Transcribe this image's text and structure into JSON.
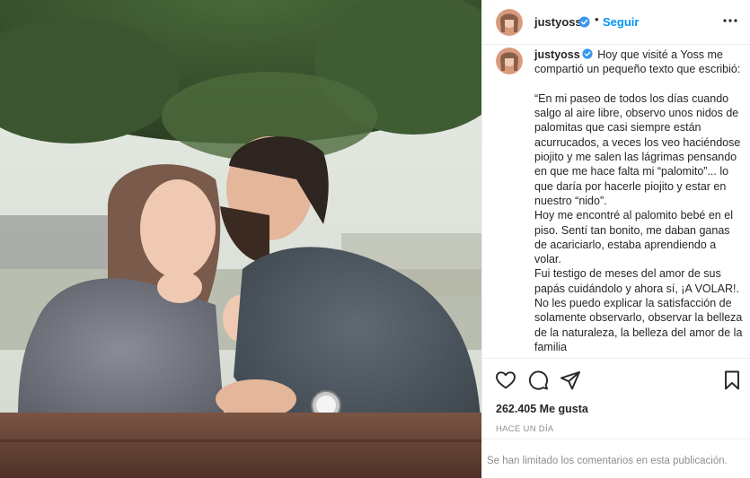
{
  "post": {
    "username": "justyoss",
    "follow_label": "Seguir",
    "separator": "•",
    "caption": "Hoy que visité a Yoss me compartió un pequeño texto que escribió:\n\n“En mi paseo de todos los días cuando salgo al aire libre, observo unos nidos de palomitas que casi siempre están acurrucados, a veces los veo haciéndose piojito y me salen las lágrimas pensando en que me hace falta mi “palomito”... lo que daría por hacerle piojito y estar en nuestro “nido”.\nHoy me encontré al palomito bebé en el piso. Sentí tan bonito, me daban ganas de acariciarlo, estaba aprendiendo a volar.\nFui testigo de meses del amor de sus papás cuidándolo y ahora sí, ¡A VOLAR!.\nNo les puedo explicar la satisfacción de solamente observarlo, observar la belleza de la naturaleza, la belleza del amor de la familia",
    "likes": "262.405 Me gusta",
    "timestamp": "HACE UN DÍA",
    "comments_notice": "Se han limitado los comentarios en esta publicación."
  },
  "icons": {
    "verified": "verified-badge-icon",
    "more": "more-options-icon",
    "like": "heart-icon",
    "comment": "comment-icon",
    "share": "share-icon",
    "save": "bookmark-icon"
  },
  "colors": {
    "link": "#0095f6",
    "verified": "#3897f0",
    "text": "#262626",
    "muted": "#8e8e8e",
    "border": "#efefef"
  }
}
